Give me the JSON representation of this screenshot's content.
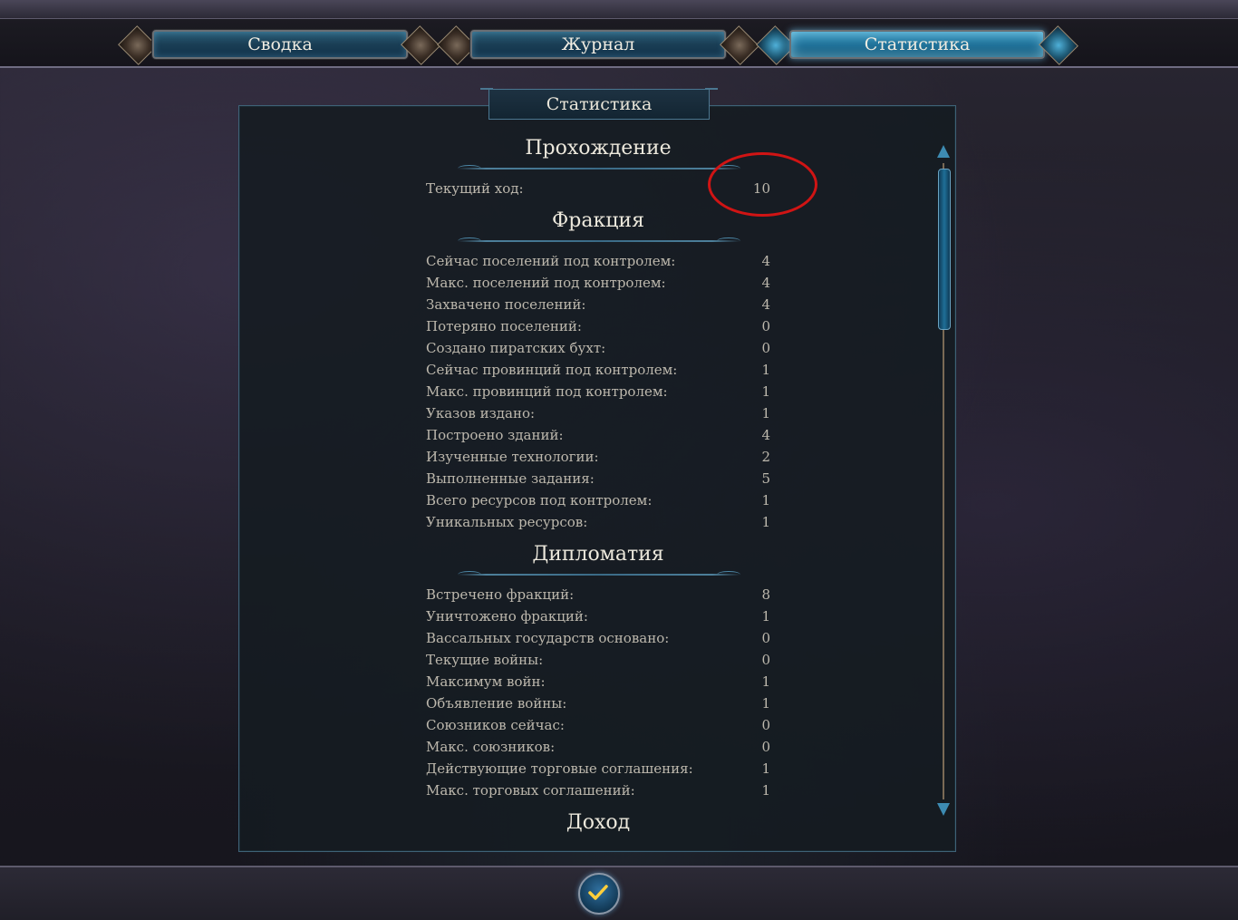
{
  "tabs": [
    {
      "label": "Сводка",
      "active": false
    },
    {
      "label": "Журнал",
      "active": false
    },
    {
      "label": "Статистика",
      "active": true
    }
  ],
  "panel_title": "Статистика",
  "sections": {
    "progress": {
      "title": "Прохождение",
      "rows": [
        {
          "label": "Текущий ход:",
          "value": "10"
        }
      ]
    },
    "faction": {
      "title": "Фракция",
      "rows": [
        {
          "label": "Сейчас поселений под контролем:",
          "value": "4"
        },
        {
          "label": "Макс. поселений под контролем:",
          "value": "4"
        },
        {
          "label": "Захвачено поселений:",
          "value": "4"
        },
        {
          "label": "Потеряно поселений:",
          "value": "0"
        },
        {
          "label": "Создано пиратских бухт:",
          "value": "0"
        },
        {
          "label": "Сейчас провинций под контролем:",
          "value": "1"
        },
        {
          "label": "Макс. провинций под контролем:",
          "value": "1"
        },
        {
          "label": "Указов издано:",
          "value": "1"
        },
        {
          "label": "Построено зданий:",
          "value": "4"
        },
        {
          "label": "Изученные технологии:",
          "value": "2"
        },
        {
          "label": "Выполненные задания:",
          "value": "5"
        },
        {
          "label": "Всего ресурсов под контролем:",
          "value": "1"
        },
        {
          "label": "Уникальных ресурсов:",
          "value": "1"
        }
      ]
    },
    "diplomacy": {
      "title": "Дипломатия",
      "rows": [
        {
          "label": "Встречено фракций:",
          "value": "8"
        },
        {
          "label": "Уничтожено фракций:",
          "value": "1"
        },
        {
          "label": "Вассальных государств основано:",
          "value": "0"
        },
        {
          "label": "Текущие войны:",
          "value": "0"
        },
        {
          "label": "Максимум войн:",
          "value": "1"
        },
        {
          "label": "Объявление войны:",
          "value": "1"
        },
        {
          "label": "Союзников сейчас:",
          "value": "0"
        },
        {
          "label": "Макс. союзников:",
          "value": "0"
        },
        {
          "label": "Действующие торговые соглашения:",
          "value": "1"
        },
        {
          "label": "Макс. торговых соглашений:",
          "value": "1"
        }
      ]
    },
    "income": {
      "title": "Доход"
    }
  },
  "colors": {
    "highlight_circle": "#d01414",
    "active_tab": "#1d6e96"
  },
  "icons": {
    "confirm": "checkmark-icon",
    "scroll_up": "arrow-up-icon",
    "scroll_down": "arrow-down-icon"
  }
}
